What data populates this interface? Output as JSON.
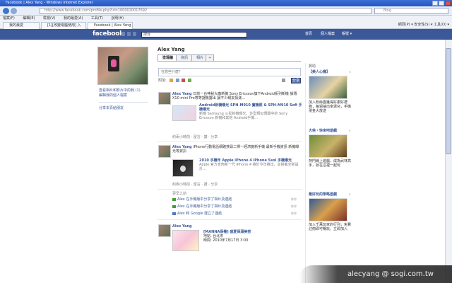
{
  "window": {
    "title": "Facebook | Alex Yang - Windows Internet Explorer"
  },
  "browser": {
    "url": "http://www.facebook.com/profile.php?id=1000020017692",
    "search_placeholder": "Bing",
    "menu": [
      "檔案(F)",
      "編輯(E)",
      "檢視(V)",
      "我的最愛(A)",
      "工具(T)",
      "說明(H)"
    ],
    "tabs": [
      {
        "label": "我的最愛"
      },
      {
        "label": "[1][改變電腦使用] 入口..."
      },
      {
        "label": "Facebook | Alex Yang"
      }
    ],
    "tools": "網頁(P) ▾  安全性(S) ▾  工具(O) ▾"
  },
  "fb": {
    "logo": "facebook",
    "search_value": "搜尋",
    "nav": {
      "home": "首頁",
      "profile": "個人檔案",
      "account": "帳號 ▾"
    }
  },
  "profile": {
    "name": "Alex Yang",
    "tabs": [
      "塗鴉牆",
      "資訊",
      "相片",
      "+"
    ],
    "left_links": [
      "查看相片和影片中的我 (1)",
      "編輯我的個人檔案",
      "分享本頁給朋友"
    ],
    "status_placeholder": "在想些什麼？",
    "attach_label": "附加:",
    "share_button": "分享"
  },
  "feed": [
    {
      "name": "Alex Yang",
      "text": "日前一台神秘大廠新機 Sony Ericsson旗下Android系列新機 據傳X10 mini Pro等等謎機露出 讓不少網友猜測...",
      "link_title": "Android新機曝光 SPH-M910 實機照 & SPH-M910 Sofi 手機曝光",
      "link_desc": "新機 Samsung 三星新機曝光，外型類似傳聞中的 Sony Ericsson 新機和其他 Android手機...",
      "meta": "約兩小時前 · 留言 · 讚 · 分享"
    },
    {
      "name": "Alex Yang",
      "text": "iPhone行動電話網路搜尋二擇一經濟變新手機 最新手機資訊 新機曝光等資訊",
      "link_title": "2010 手機年 Apple iPhone 4 iPhone 5sol 手機曝光",
      "link_desc": "Apple 官方宣佈新一代 iPhone 4 將於今年推出，並搭載全新設計...",
      "meta": "約兩小時前 · 留言 · 讚 · 分享"
    }
  ],
  "mini_feed": {
    "header": "更早之前",
    "items": [
      "Alex 在手機版中分享了相片及連結",
      "Alex 在手機版中分享了相片及連結",
      "Alex 和 Google 建立了連結"
    ],
    "hide": "移除"
  },
  "feed3": {
    "name": "Alex Yang",
    "link_title": "[MANNA保養] 盛夏保濕美容",
    "line1": "地點: 台北市",
    "line2": "時間: 2010年7月17日 3:00"
  },
  "right": {
    "sponsored": "贊助",
    "ads": [
      {
        "title": "【美人心機】",
        "desc": "加入粉絲團獲得好康好禮物，每週抽出幸運兒，手機現金大放送",
        "action": "讚"
      },
      {
        "title": "大俠・快來吧遊戲",
        "desc": "熱門線上遊戲，成為武林高手，就在這裡一起玩",
        "action": "讚"
      },
      {
        "title": "最好玩的策略遊戲",
        "desc": "加入千萬玩家的行列，免費註冊即可暢玩，立即加入",
        "action": "讚"
      }
    ],
    "close": "×"
  },
  "watermark": "alecyang  @ sogi.com.tw"
}
